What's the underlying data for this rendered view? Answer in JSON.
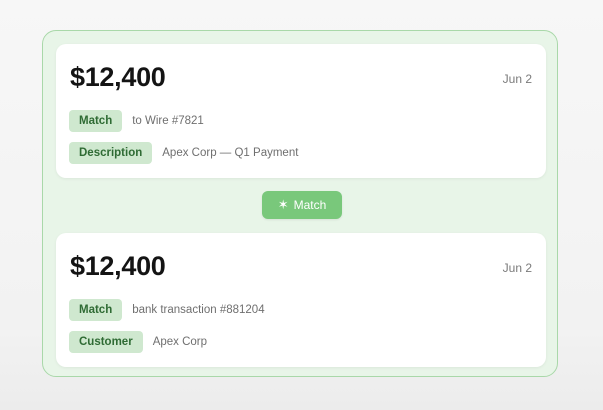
{
  "top_card": {
    "amount": "$12,400",
    "date": "Jun 2",
    "rows": [
      {
        "tag": "Match",
        "text": "to Wire #7821"
      },
      {
        "tag": "Description",
        "text": "Apex Corp — Q1 Payment"
      }
    ]
  },
  "match_button": {
    "icon": "✶",
    "label": "Match"
  },
  "bottom_card": {
    "amount": "$12,400",
    "date": "Jun 2",
    "rows": [
      {
        "tag": "Match",
        "text": "bank transaction #881204"
      },
      {
        "tag": "Customer",
        "text": "Apex Corp"
      }
    ]
  },
  "colors": {
    "panel_background": "#e8f5e8",
    "panel_border": "#a9d8a9",
    "tag_background": "#cfe8cf",
    "tag_text": "#2f6b34",
    "button_background": "#79c87b"
  }
}
